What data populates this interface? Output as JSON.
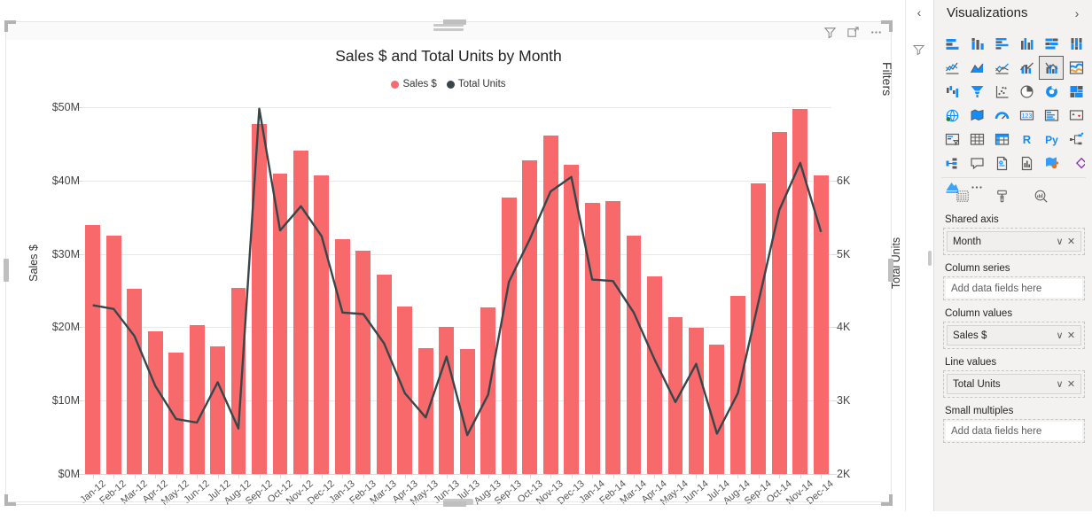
{
  "chart_data": {
    "type": "bar",
    "title": "Sales $ and Total Units by Month",
    "xlabel": "",
    "ylabel": "Sales $",
    "y2label": "Total Units",
    "ylim": [
      0,
      50000000
    ],
    "y2lim": [
      2000,
      7000
    ],
    "y_ticks": [
      "$0M",
      "$10M",
      "$20M",
      "$30M",
      "$40M",
      "$50M"
    ],
    "y_tick_values": [
      0,
      10000000,
      20000000,
      30000000,
      40000000,
      50000000
    ],
    "y2_ticks": [
      "2K",
      "3K",
      "4K",
      "5K",
      "6K"
    ],
    "y2_tick_values": [
      2000,
      3000,
      4000,
      5000,
      6000
    ],
    "grid": true,
    "legend_position": "top",
    "categories": [
      "Jan-12",
      "Feb-12",
      "Mar-12",
      "Apr-12",
      "May-12",
      "Jun-12",
      "Jul-12",
      "Aug-12",
      "Sep-12",
      "Oct-12",
      "Nov-12",
      "Dec-12",
      "Jan-13",
      "Feb-13",
      "Mar-13",
      "Apr-13",
      "May-13",
      "Jun-13",
      "Jul-13",
      "Aug-13",
      "Sep-13",
      "Oct-13",
      "Nov-13",
      "Dec-13",
      "Jan-14",
      "Feb-14",
      "Mar-14",
      "Apr-14",
      "May-14",
      "Jun-14",
      "Jul-14",
      "Aug-14",
      "Sep-14",
      "Oct-14",
      "Nov-14",
      "Dec-14"
    ],
    "series": [
      {
        "name": "Sales $",
        "type": "bar",
        "axis": "left",
        "color": "#F8696B",
        "values": [
          33900000,
          32500000,
          25200000,
          19500000,
          16500000,
          20300000,
          17400000,
          25400000,
          47700000,
          41000000,
          44100000,
          40700000,
          32000000,
          30400000,
          27200000,
          22800000,
          17100000,
          20100000,
          17000000,
          22700000,
          37700000,
          42700000,
          46100000,
          42100000,
          36900000,
          37200000,
          32500000,
          26900000,
          21400000,
          19900000,
          17600000,
          24300000,
          39600000,
          46600000,
          49700000,
          40700000
        ]
      },
      {
        "name": "Total Units",
        "type": "line",
        "axis": "right",
        "color": "#374649",
        "values": [
          4300,
          4250,
          3880,
          3200,
          2750,
          2700,
          3250,
          2620,
          6980,
          5320,
          5650,
          5240,
          4200,
          4180,
          3780,
          3100,
          2770,
          3600,
          2530,
          3080,
          4620,
          5200,
          5850,
          6050,
          4650,
          4630,
          4200,
          3560,
          2980,
          3500,
          2550,
          3100,
          4350,
          5600,
          6240,
          5300
        ]
      }
    ]
  },
  "visual": {
    "tools": [
      {
        "name": "filter-icon",
        "label": "Filters"
      },
      {
        "name": "focus-mode-icon",
        "label": "Focus mode"
      },
      {
        "name": "more-options-icon",
        "label": "More options"
      }
    ]
  },
  "filters_pane": {
    "collapse_label": "‹",
    "title": "Filters",
    "icon": "filter-icon"
  },
  "visualizations_pane": {
    "title": "Visualizations",
    "expand_label": "›",
    "icons": [
      "stacked-bar-chart",
      "stacked-column-chart",
      "clustered-bar-chart",
      "clustered-column-chart",
      "100-stacked-bar-chart",
      "100-stacked-column-chart",
      "line-chart",
      "area-chart",
      "stacked-area-chart",
      "line-and-stacked-column-chart",
      "line-and-clustered-column-chart",
      "ribbon-chart",
      "waterfall-chart",
      "funnel-chart",
      "scatter-chart",
      "pie-chart",
      "donut-chart",
      "treemap",
      "map",
      "filled-map",
      "gauge",
      "card",
      "multi-row-card",
      "kpi",
      "slicer",
      "table",
      "matrix",
      "r-script-visual",
      "python-visual",
      "decomposition-tree",
      "key-influencers",
      "q-and-a",
      "paginated-report",
      "smart-narrative",
      "azure-map",
      "power-apps",
      "arcgis-maps",
      "more-visuals"
    ],
    "selected_icon": "line-and-clustered-column-chart",
    "well_tabs": [
      {
        "name": "fields-tab",
        "label": "Fields"
      },
      {
        "name": "format-tab",
        "label": "Format"
      },
      {
        "name": "analytics-tab",
        "label": "Analytics"
      }
    ],
    "wells": [
      {
        "label": "Shared axis",
        "field": "Month",
        "placeholder": null
      },
      {
        "label": "Column series",
        "field": null,
        "placeholder": "Add data fields here"
      },
      {
        "label": "Column values",
        "field": "Sales $",
        "placeholder": null
      },
      {
        "label": "Line values",
        "field": "Total Units",
        "placeholder": null
      },
      {
        "label": "Small multiples",
        "field": null,
        "placeholder": "Add data fields here"
      }
    ],
    "chip_menu_glyph": "∨",
    "chip_remove_glyph": "✕"
  },
  "colors": {
    "bar": "#F8696B",
    "line": "#374649",
    "grid": "#E8E8E8",
    "pane_bg": "#F3F2F1",
    "accent": "#0078D4"
  }
}
